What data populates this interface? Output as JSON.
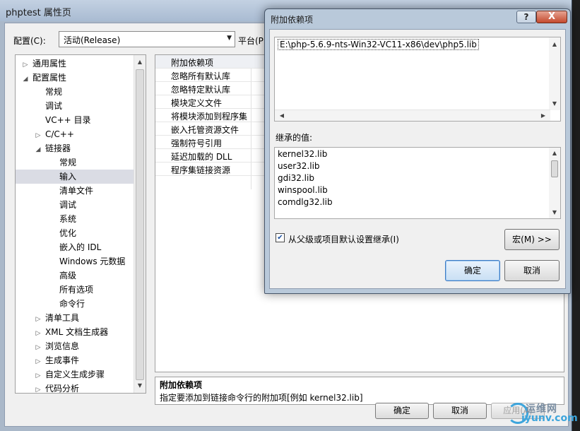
{
  "main_window": {
    "title": "phptest 属性页",
    "config_label": "配置(C):",
    "config_value": "活动(Release)",
    "platform_label": "平台(P",
    "buttons": {
      "ok": "确定",
      "cancel": "取消",
      "apply": "应用(A)"
    }
  },
  "tree": {
    "items": [
      {
        "label": "通用属性",
        "arrow": "▷"
      },
      {
        "label": "配置属性",
        "arrow": "◢"
      },
      {
        "label": "常规",
        "arrow": ""
      },
      {
        "label": "调试",
        "arrow": ""
      },
      {
        "label": "VC++ 目录",
        "arrow": ""
      },
      {
        "label": "C/C++",
        "arrow": "▷"
      },
      {
        "label": "链接器",
        "arrow": "◢"
      },
      {
        "label": "常规",
        "arrow": ""
      },
      {
        "label": "输入",
        "arrow": ""
      },
      {
        "label": "清单文件",
        "arrow": ""
      },
      {
        "label": "调试",
        "arrow": ""
      },
      {
        "label": "系统",
        "arrow": ""
      },
      {
        "label": "优化",
        "arrow": ""
      },
      {
        "label": "嵌入的 IDL",
        "arrow": ""
      },
      {
        "label": "Windows 元数据",
        "arrow": ""
      },
      {
        "label": "高级",
        "arrow": ""
      },
      {
        "label": "所有选项",
        "arrow": ""
      },
      {
        "label": "命令行",
        "arrow": ""
      },
      {
        "label": "清单工具",
        "arrow": "▷"
      },
      {
        "label": "XML 文档生成器",
        "arrow": "▷"
      },
      {
        "label": "浏览信息",
        "arrow": "▷"
      },
      {
        "label": "生成事件",
        "arrow": "▷"
      },
      {
        "label": "自定义生成步骤",
        "arrow": "▷"
      },
      {
        "label": "代码分析",
        "arrow": "▷"
      }
    ]
  },
  "grid": {
    "rows": [
      "附加依赖项",
      "忽略所有默认库",
      "忽略特定默认库",
      "模块定义文件",
      "将模块添加到程序集",
      "嵌入托管资源文件",
      "强制符号引用",
      "延迟加载的 DLL",
      "程序集链接资源"
    ]
  },
  "description": {
    "title": "附加依赖项",
    "text": "指定要添加到链接命令行的附加项[例如 kernel32.lib]"
  },
  "dialog": {
    "title": "附加依赖项",
    "help": "?",
    "close": "X",
    "edit_value": "E:\\php-5.6.9-nts-Win32-VC11-x86\\dev\\php5.lib",
    "inherited_label": "继承的值:",
    "inherited_values": [
      "kernel32.lib",
      "user32.lib",
      "gdi32.lib",
      "winspool.lib",
      "comdlg32.lib"
    ],
    "inherit_checkbox_label": "从父级或项目默认设置继承(I)",
    "inherit_checked": true,
    "macro_button": "宏(M) >>",
    "ok_button": "确定",
    "cancel_button": "取消"
  },
  "watermark": {
    "line1": "运维网",
    "line2": "iyunv.com"
  }
}
